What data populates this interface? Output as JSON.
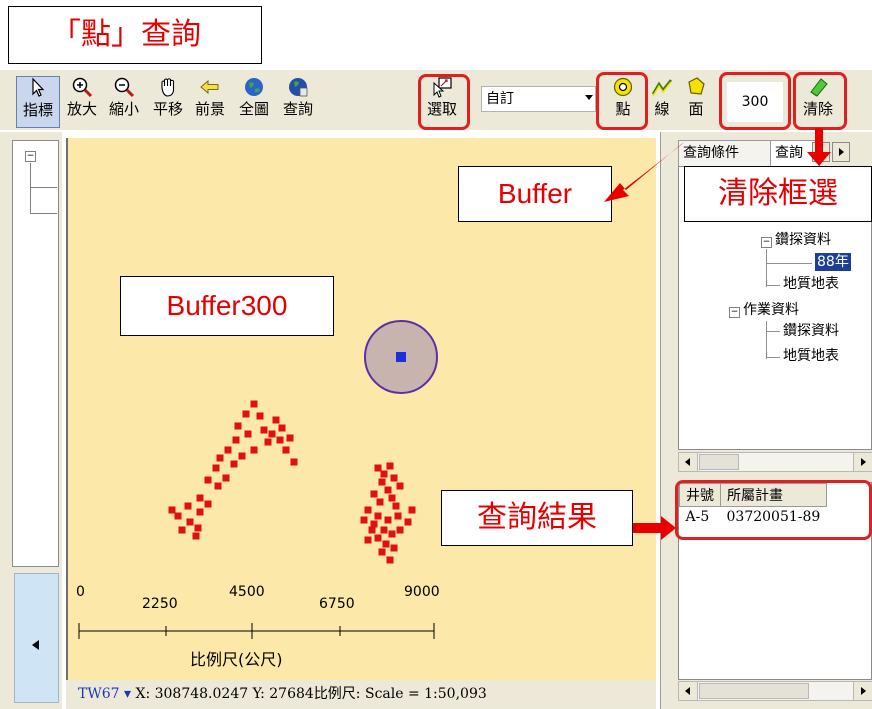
{
  "title": "「點」查詢",
  "toolbar": {
    "tools": [
      {
        "name": "pointer",
        "label": "指標",
        "icon": "arrow-pointer-icon"
      },
      {
        "name": "zoom-in",
        "label": "放大",
        "icon": "zoom-in-icon"
      },
      {
        "name": "zoom-out",
        "label": "縮小",
        "icon": "zoom-out-icon"
      },
      {
        "name": "pan",
        "label": "平移",
        "icon": "hand-icon"
      },
      {
        "name": "previous",
        "label": "前景",
        "icon": "back-arrow-icon"
      },
      {
        "name": "full-extent",
        "label": "全圖",
        "icon": "globe-icon"
      },
      {
        "name": "query",
        "label": "查詢",
        "icon": "globe-query-icon"
      },
      {
        "name": "select",
        "label": "選取",
        "icon": "select-box-icon"
      }
    ],
    "dropdown_value": "自訂",
    "shape_tools": [
      {
        "name": "point",
        "label": "點",
        "icon": "point-target-icon"
      },
      {
        "name": "line",
        "label": "線",
        "icon": "line-icon"
      },
      {
        "name": "polygon",
        "label": "面",
        "icon": "polygon-icon"
      }
    ],
    "buffer_value": "300",
    "clear": {
      "label": "清除",
      "icon": "eraser-icon"
    }
  },
  "callouts": {
    "buffer": "Buffer",
    "clear_selection": "清除框選",
    "buffer300": "Buffer300",
    "query_result": "查詢結果"
  },
  "scale_bar": {
    "ticks": [
      "0",
      "2250",
      "4500",
      "6750",
      "9000"
    ],
    "caption": "比例尺(公尺)"
  },
  "status_bar": {
    "crs": "TW67",
    "coords": "X: 308748.0247 Y: 27684",
    "scale": "比例尺: Scale = 1:50,093"
  },
  "right_panel": {
    "tabs": [
      "查詢條件",
      "查詢"
    ],
    "tree": [
      {
        "label": "鑽探資料",
        "expander": "−"
      },
      {
        "label": "88年",
        "selected": true
      },
      {
        "label": "地質地表"
      },
      {
        "label": "作業資料",
        "expander": "−"
      },
      {
        "label": "鑽探資料"
      },
      {
        "label": "地質地表"
      }
    ],
    "results": {
      "columns": [
        "井號",
        "所屬計畫"
      ],
      "rows": [
        [
          "A-5",
          "03720051-89"
        ]
      ]
    }
  },
  "colors": {
    "map_bg": "#fce8a8",
    "points": "#e01010",
    "buffer_fill": "#c8b4ae",
    "buffer_stroke": "#5a2fa8",
    "query_point": "#1a2fe0",
    "callout_text": "#e60000",
    "highlight": "#e02020"
  }
}
